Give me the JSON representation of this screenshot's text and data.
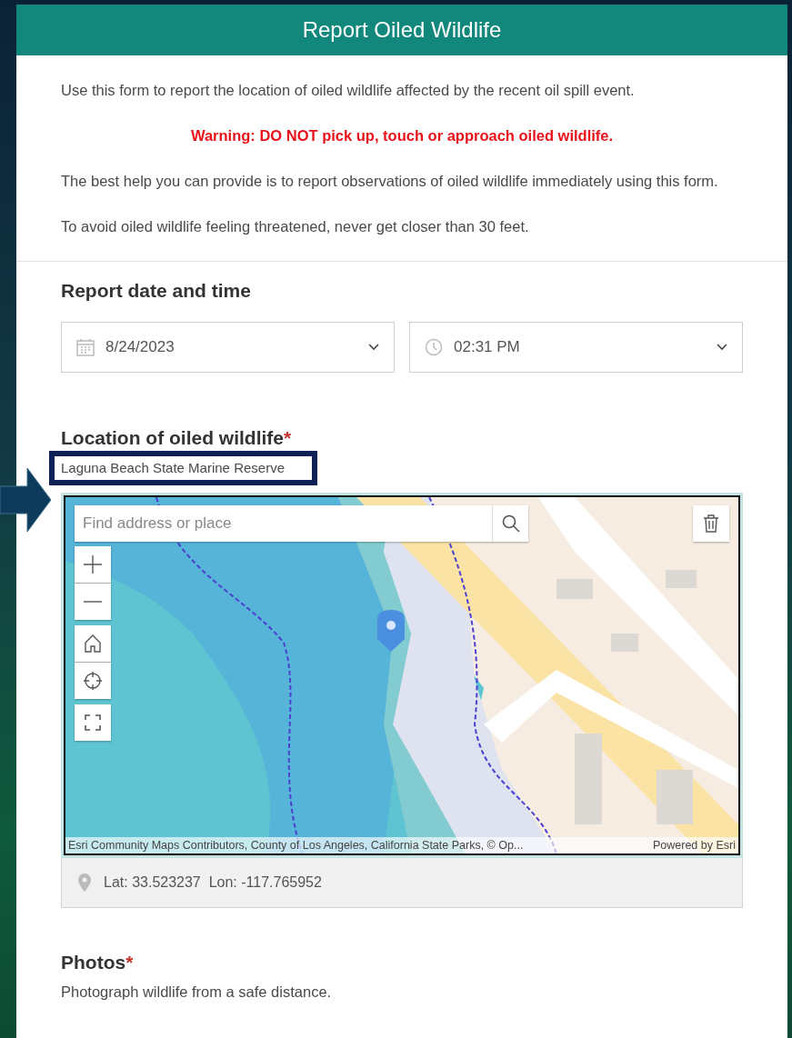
{
  "header": {
    "title": "Report Oiled Wildlife"
  },
  "intro": [
    {
      "kind": "plain",
      "text": "Use this form to report the location of oiled wildlife affected by the recent oil spill event."
    },
    {
      "kind": "warning",
      "text": "Warning: DO NOT pick up, touch or approach oiled wildlife."
    },
    {
      "kind": "plain",
      "text": "The best help you can provide is to report observations of oiled wildlife immediately using this form."
    },
    {
      "kind": "plain",
      "text": "To avoid oiled wildlife feeling threatened, never get closer than 30 feet."
    }
  ],
  "date_time": {
    "label": "Report date and time",
    "date": "8/24/2023",
    "time": "02:31 PM"
  },
  "location": {
    "label": "Location of oiled wildlife",
    "required_mark": "*",
    "description": "Laguna Beach State Marine Reserve",
    "highlighted": true,
    "map": {
      "kind": "picture",
      "search_placeholder": "Find address or place",
      "attribution": "Esri Community Maps Contributors, County of Los Angeles, California State Parks, © Op...",
      "powered_by": "Powered by Esri"
    },
    "coordinates": "Lat: 33.523237  Lon: -117.765952"
  },
  "photos": {
    "label": "Photos",
    "required_mark": "*",
    "description": "Photograph wildlife from a safe distance."
  }
}
